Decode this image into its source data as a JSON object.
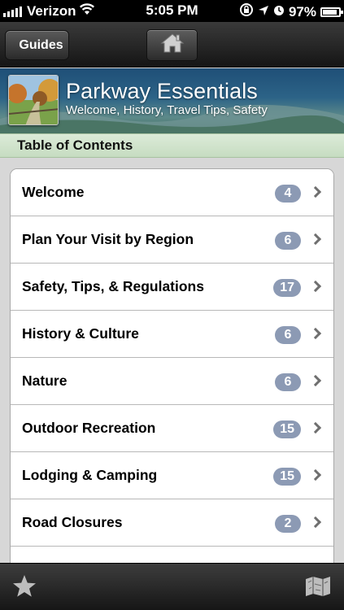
{
  "status_bar": {
    "carrier": "Verizon",
    "time": "5:05 PM",
    "battery": "97%"
  },
  "nav": {
    "back_label": "Guides",
    "home_icon": "home-icon"
  },
  "banner": {
    "title": "Parkway Essentials",
    "subtitle": "Welcome, History, Travel Tips, Safety"
  },
  "section": {
    "title": "Table of Contents"
  },
  "items": [
    {
      "label": "Welcome",
      "count": "4"
    },
    {
      "label": "Plan Your Visit by Region",
      "count": "6"
    },
    {
      "label": "Safety, Tips, & Regulations",
      "count": "17"
    },
    {
      "label": "History & Culture",
      "count": "6"
    },
    {
      "label": "Nature",
      "count": "6"
    },
    {
      "label": "Outdoor Recreation",
      "count": "15"
    },
    {
      "label": "Lodging & Camping",
      "count": "15"
    },
    {
      "label": "Road Closures",
      "count": "2"
    }
  ],
  "toolbar": {
    "left_icon": "star-icon",
    "right_icon": "map-icon"
  },
  "colors": {
    "badge": "#8c9ab4",
    "section_header": "#c6dcc1",
    "banner": "#2c6387"
  }
}
